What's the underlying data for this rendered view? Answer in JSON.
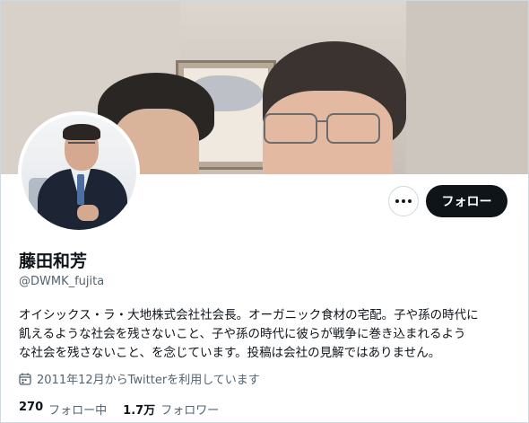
{
  "profile": {
    "name": "藤田和芳",
    "handle": "@DWMK_fujita",
    "bio": "オイシックス・ラ・大地株式会社社会長。オーガニック食材の宅配。子や孫の時代に\n飢えるような社会を残さないこと、子や孫の時代に彼らが戦争に巻き込まれるよう\nな社会を残さないこと、を念じています。投稿は会社の見解ではありません。",
    "joined": "2011年12月からTwitterを利用しています",
    "following_count": "270",
    "following_label": "フォロー中",
    "followers_count": "1.7万",
    "followers_label": "フォロワー"
  },
  "actions": {
    "follow_label": "フォロー",
    "more_icon": "more-horizontal-icon"
  },
  "icons": {
    "calendar": "calendar-icon"
  },
  "colors": {
    "text_primary": "#0f1419",
    "text_secondary": "#536471",
    "button_dark": "#0f1419",
    "border": "#cfd9de"
  }
}
